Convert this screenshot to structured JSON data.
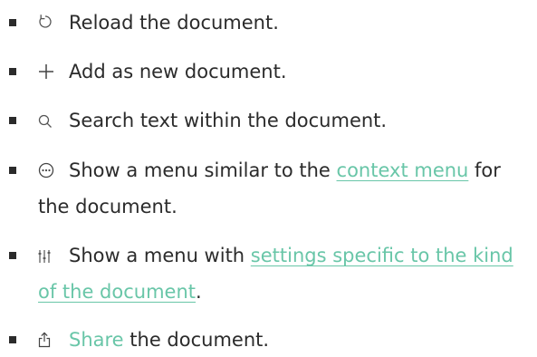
{
  "items": [
    {
      "icon": "reload-icon",
      "text": "Reload the document."
    },
    {
      "icon": "plus-icon",
      "text": "Add as new document."
    },
    {
      "icon": "search-icon",
      "text": "Search text within the document."
    },
    {
      "icon": "more-icon",
      "text_before": "Show a menu similar to the ",
      "link": "context menu",
      "text_after": " for the document."
    },
    {
      "icon": "sliders-icon",
      "text_before": "Show a menu with ",
      "link": "settings specific to the kind of the document",
      "text_after": "."
    },
    {
      "icon": "share-icon",
      "link": "Share",
      "text_after": " the document."
    }
  ],
  "colors": {
    "link": "#69c6a8",
    "text": "#2b2b2b"
  }
}
